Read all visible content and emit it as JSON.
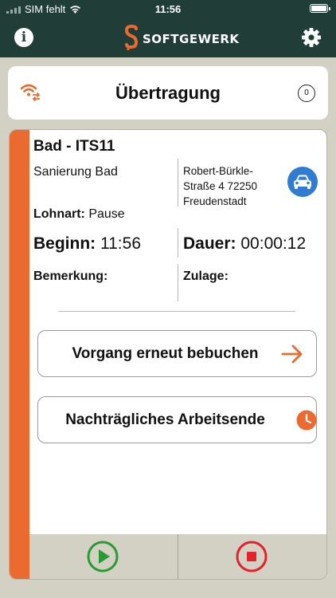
{
  "status_bar": {
    "carrier": "SIM fehlt",
    "time": "11:56"
  },
  "nav": {
    "brand": "SOFTGEWERK",
    "info_icon": "info-icon",
    "settings_icon": "gear-icon"
  },
  "transfer": {
    "title": "Übertragung",
    "count": "0",
    "icon": "wifi-sync-icon"
  },
  "job": {
    "title": "Bad - ITS11",
    "description": "Sanierung Bad",
    "address_line1": "Robert-Bürkle-",
    "address_line2": "Straße 4 72250",
    "address_line3": "Freudenstadt",
    "wage_label": "Lohnart:",
    "wage_value": "Pause",
    "start_label": "Beginn:",
    "start_value": "11:56",
    "duration_label": "Dauer:",
    "duration_value": "00:00:12",
    "remark_label": "Bemerkung:",
    "bonus_label": "Zulage:"
  },
  "actions": {
    "rebook_label": "Vorgang erneut bebuchen",
    "end_label": "Nachträgliches Arbeitsende"
  },
  "bottom_bar": {
    "play_icon": "play-icon",
    "stop_icon": "stop-icon"
  },
  "colors": {
    "header": "#203e37",
    "accent": "#ea6a30",
    "background": "#d3d0c4",
    "play": "#2a9a32",
    "stop": "#e3222a",
    "car": "#2f7cd2"
  }
}
